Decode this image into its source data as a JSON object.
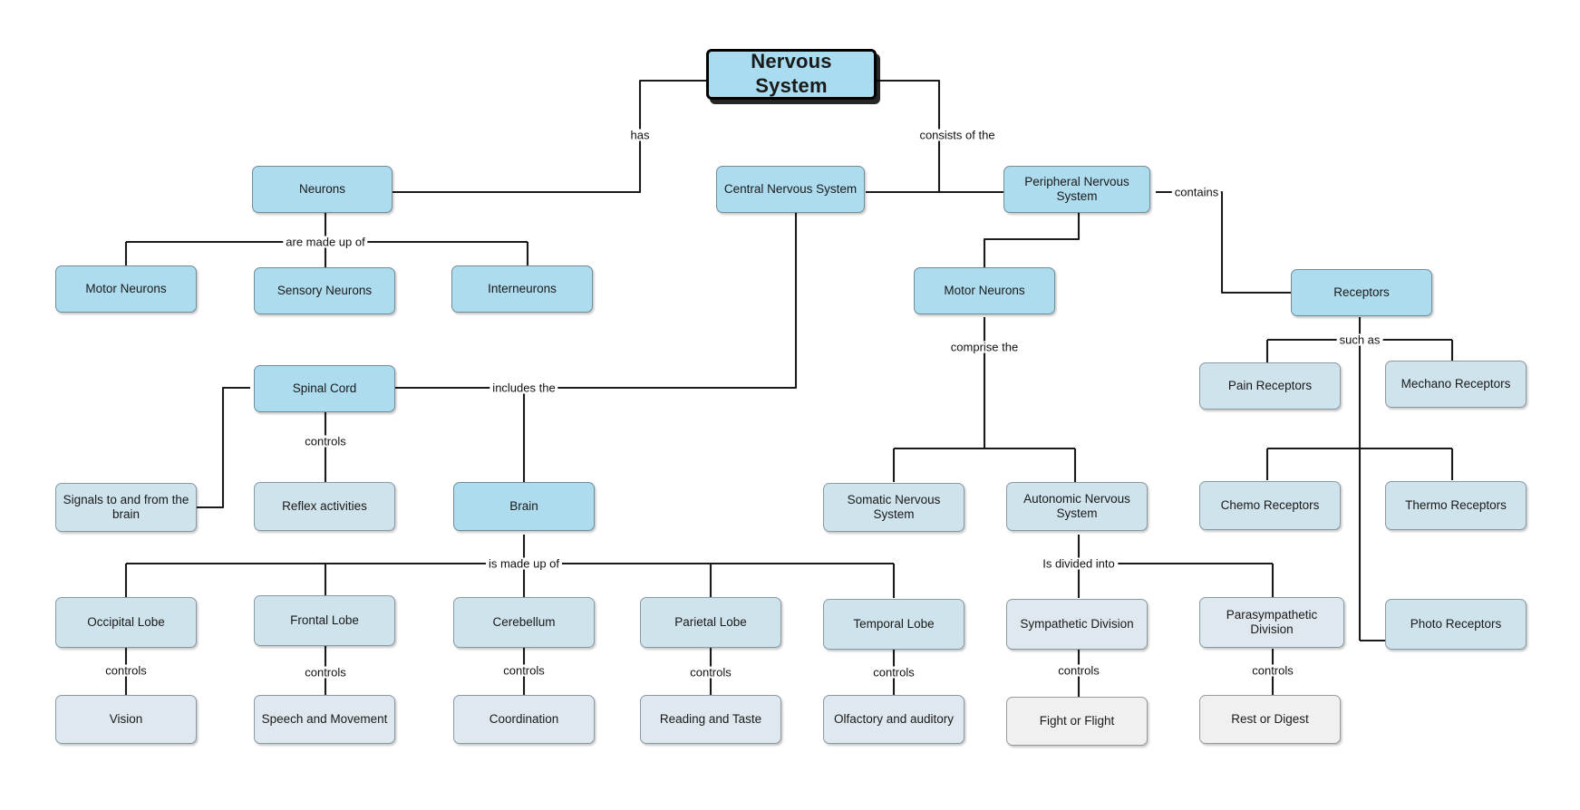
{
  "diagram": {
    "title": "Nervous System",
    "type": "concept-map",
    "colors": {
      "root_fill": "#a9dcf0",
      "tier1_fill": "#aedcef",
      "tier2_fill": "#cfe3ec",
      "tier3_fill": "#dfe8ee",
      "tier4_fill": "#f0f0f0",
      "line": "#1a1a1a",
      "background": "#ffffff"
    }
  },
  "nodes": {
    "nervous_system": "Nervous System",
    "neurons": "Neurons",
    "central_nervous_system": "Central Nervous System",
    "peripheral_nervous_system": "Peripheral Nervous System",
    "motor_neurons_a": "Motor Neurons",
    "sensory_neurons": "Sensory Neurons",
    "interneurons": "Interneurons",
    "motor_neurons_b": "Motor Neurons",
    "receptors": "Receptors",
    "spinal_cord": "Spinal Cord",
    "pain_receptors": "Pain Receptors",
    "mechano_receptors": "Mechano Receptors",
    "signals_to_and_from_the_brain": "Signals to and from the brain",
    "reflex_activities": "Reflex activities",
    "brain": "Brain",
    "somatic_nervous_system": "Somatic Nervous System",
    "autonomic_nervous_system": "Autonomic Nervous System",
    "chemo_receptors": "Chemo Receptors",
    "thermo_receptors": "Thermo Receptors",
    "occipital_lobe": "Occipital Lobe",
    "frontal_lobe": "Frontal Lobe",
    "cerebellum": "Cerebellum",
    "parietal_lobe": "Parietal Lobe",
    "temporal_lobe": "Temporal Lobe",
    "sympathetic_division": "Sympathetic Division",
    "parasympathetic_division": "Parasympathetic Division",
    "photo_receptors": "Photo Receptors",
    "vision": "Vision",
    "speech_and_movement": "Speech and Movement",
    "coordination": "Coordination",
    "reading_and_taste": "Reading and Taste",
    "olfactory_and_auditory": "Olfactory and auditory",
    "fight_or_flight": "Fight or Flight",
    "rest_or_digest": "Rest or Digest"
  },
  "edge_labels": {
    "has": "has",
    "consists_of_the": "consists of the",
    "are_made_up_of": "are made up of",
    "contains": "contains",
    "comprise_the": "comprise the",
    "includes_the": "includes the",
    "such_as": "such as",
    "controls_spinal": "controls",
    "is_made_up_of": "is made up of",
    "is_divided_into": "Is divided into",
    "controls_occipital": "controls",
    "controls_frontal": "controls",
    "controls_cerebellum": "controls",
    "controls_parietal": "controls",
    "controls_temporal": "controls",
    "controls_sympathetic": "controls",
    "controls_parasympathetic": "controls"
  }
}
